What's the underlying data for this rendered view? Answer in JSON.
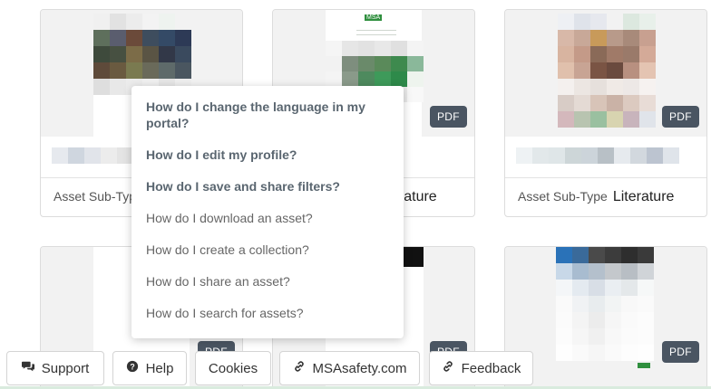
{
  "cards": [
    {
      "subtype_label": "Asset Sub-Typ",
      "subtype_value": "",
      "badge": ""
    },
    {
      "subtype_label": "",
      "subtype_value": "erature",
      "badge": "PDF"
    },
    {
      "subtype_label": "Asset Sub-Type",
      "subtype_value": "Literature",
      "badge": "PDF"
    },
    {
      "badge": "PDF"
    },
    {
      "badge": "PDF"
    },
    {
      "badge": "PDF"
    }
  ],
  "faq": {
    "items": [
      "How do I change the language in my portal?",
      "How do I edit my profile?",
      "How do I save and share filters?",
      "How do I download an asset?",
      "How do I create a collection?",
      "How do I share an asset?",
      "How do I search for assets?"
    ]
  },
  "footer": {
    "support": "Support",
    "help": "Help",
    "cookies": "Cookies",
    "msasafety": "MSAsafety.com",
    "feedback": "Feedback"
  },
  "thumbnail_text": {
    "msa_logo": "MSA"
  },
  "colors": {
    "badge_bg": "#4a5562",
    "faq_bold": "#5a6670",
    "faq_normal": "#666666",
    "bottom_line": "#d9ebde"
  }
}
